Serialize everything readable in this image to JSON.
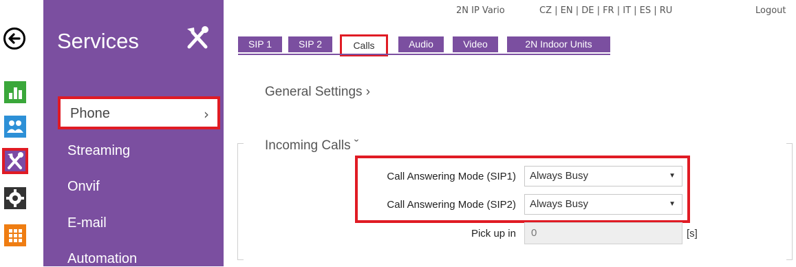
{
  "topbar": {
    "device_name": "2N IP Vario",
    "languages": "CZ | EN | DE | FR | IT | ES | RU",
    "logout": "Logout"
  },
  "rail": {
    "icons": [
      "back-arrow-icon",
      "status-chart-icon",
      "directory-users-icon",
      "services-tools-icon",
      "settings-gear-icon",
      "apps-grid-icon"
    ],
    "active": "services-tools-icon"
  },
  "services": {
    "title": "Services",
    "items": [
      {
        "label": "Phone",
        "selected": true
      },
      {
        "label": "Streaming"
      },
      {
        "label": "Onvif"
      },
      {
        "label": "E-mail"
      },
      {
        "label": "Automation"
      }
    ]
  },
  "tabs": [
    {
      "label": "SIP 1"
    },
    {
      "label": "SIP 2"
    },
    {
      "label": "Calls",
      "active": true
    },
    {
      "label": "Audio"
    },
    {
      "label": "Video"
    },
    {
      "label": "2N Indoor Units"
    }
  ],
  "sections": {
    "general": "General Settings ›",
    "incoming": "Incoming Calls ˇ"
  },
  "fields": {
    "sip1_label": "Call Answering Mode (SIP1)",
    "sip1_value": "Always Busy",
    "sip2_label": "Call Answering Mode (SIP2)",
    "sip2_value": "Always Busy",
    "pickup_label": "Pick up in",
    "pickup_value": "0",
    "pickup_unit": "[s]"
  },
  "colors": {
    "accent": "#7b4fa0",
    "highlight": "#e01b24"
  }
}
